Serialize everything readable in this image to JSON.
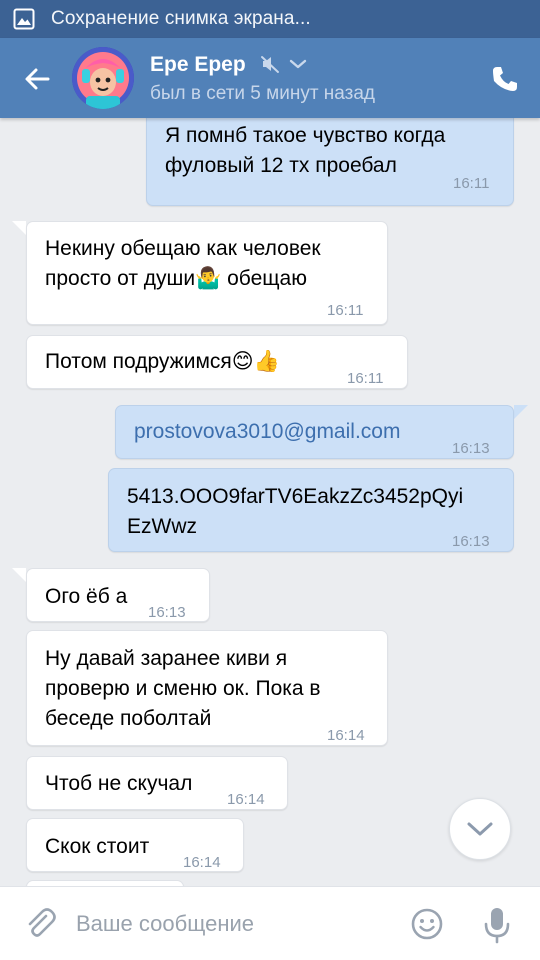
{
  "status_bar": {
    "notification": "Сохранение снимка экрана..."
  },
  "header": {
    "name": "Ере Ерер",
    "last_seen": "был в сети 5 минут назад"
  },
  "messages": [
    {
      "dir": "out",
      "lines": [
        "Я помнб такое чувство когда",
        "фуловый 12 тх   проебал"
      ],
      "time": "16:11"
    },
    {
      "dir": "in",
      "lines": [
        "Некину обещаю как человек",
        "просто от души🤷‍♂️ обещаю"
      ],
      "time": "16:11"
    },
    {
      "dir": "in",
      "lines": [
        "Потом подружимся😊👍"
      ],
      "time": "16:11"
    },
    {
      "dir": "out",
      "lines": [
        "prostovova3010@gmail.com"
      ],
      "time": "16:13"
    },
    {
      "dir": "out",
      "lines": [
        "5413.OOO9farTV6EakzZc3452pQyi",
        "EzWwz"
      ],
      "time": "16:13"
    },
    {
      "dir": "in",
      "lines": [
        "Ого ёб а"
      ],
      "time": "16:13"
    },
    {
      "dir": "in",
      "lines": [
        "Ну давай заранее киви я",
        "проверю и сменю ок. Пока в",
        "беседе поболтай"
      ],
      "time": "16:14"
    },
    {
      "dir": "in",
      "lines": [
        "Чтоб не скучал"
      ],
      "time": "16:14"
    },
    {
      "dir": "in",
      "lines": [
        "Скок стоит"
      ],
      "time": "16:14"
    }
  ],
  "composer": {
    "placeholder": "Ваше сообщение"
  },
  "icons": {
    "status": "gallery-icon",
    "back": "arrow-left-icon",
    "mute": "muted-speaker-icon",
    "dropdown": "chevron-down-icon",
    "call": "phone-icon",
    "scroll": "chevron-down-icon",
    "attach": "paperclip-icon",
    "emoji": "smiley-icon",
    "voice": "microphone-icon"
  },
  "colors": {
    "header": "#5181b8",
    "status_bar": "#3c6294",
    "chat_bg": "#ebedf0",
    "bubble_in": "#ffffff",
    "bubble_out": "#cce0f7",
    "link": "#3d6fae"
  }
}
